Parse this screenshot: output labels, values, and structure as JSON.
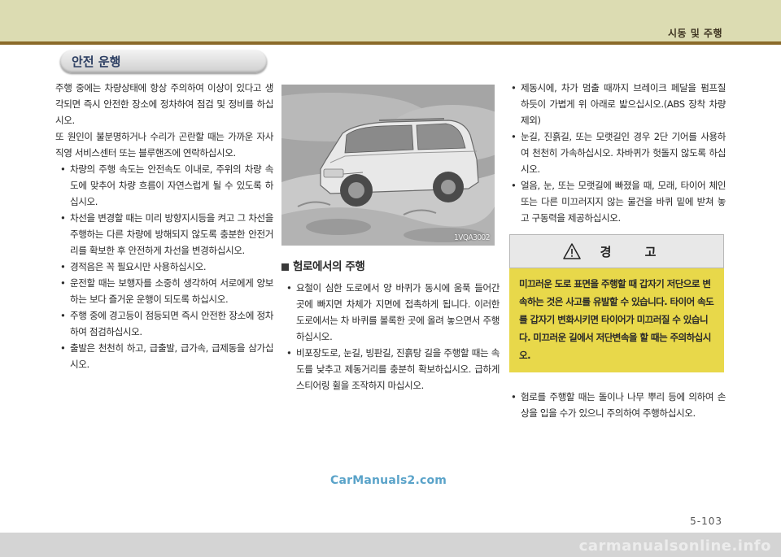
{
  "header": {
    "title": "시동 및 주행"
  },
  "section": {
    "title": "안전 운행"
  },
  "col1": {
    "para1": "주행 중에는 차량상태에 항상 주의하여 이상이 있다고 생각되면 즉시 안전한 장소에 정차하여 점검 및 정비를 하십시오.",
    "para2": "또 원인이 불분명하거나 수리가 곤란할 때는 가까운 자사 직영 서비스센터 또는 블루핸즈에 연락하십시오.",
    "bullets": [
      "차량의 주행 속도는 안전속도 이내로, 주위의 차량 속도에 맞추어 차량 흐름이 자연스럽게 될 수 있도록 하십시오.",
      "차선을 변경할 때는 미리 방향지시등을 켜고 그 차선을 주행하는 다른 차량에 방해되지 않도록 충분한 안전거리를 확보한 후 안전하게 차선을 변경하십시오.",
      "경적음은 꼭 필요시만 사용하십시오.",
      "운전할 때는 보행자를 소중히 생각하여 서로에게 양보하는 보다 즐거운 운행이 되도록 하십시오.",
      "주행 중에 경고등이 점등되면 즉시 안전한 장소에 정차하여 점검하십시오.",
      "출발은 천천히 하고, 급출발, 급가속, 급제동을 삼가십시오."
    ]
  },
  "image": {
    "code": "1VQA3002"
  },
  "col2": {
    "heading": "험로에서의 주행",
    "bullets": [
      "요철이 심한 도로에서 양 바퀴가 동시에 움푹 들어간 곳에 빠지면 차체가 지면에 접촉하게 됩니다. 이러한 도로에서는 차 바퀴를 볼록한 곳에 올려 놓으면서 주행 하십시오.",
      "비포장도로, 눈길, 빙판길, 진흙탕 길을 주행할 때는 속도를 낮추고 제동거리를 충분히 확보하십시오. 급하게 스티어링 휠을 조작하지 마십시오."
    ]
  },
  "col3": {
    "bullets": [
      "제동시에, 차가 멈출 때까지 브레이크 페달을 펌프질 하듯이 가볍게 위 아래로 밟으십시오.(ABS 장착 차량 제외)",
      "눈길, 진흙길, 또는 모랫길인 경우 2단 기어를 사용하여 천천히 가속하십시오. 차바퀴가 헛돌지 않도록 하십시오.",
      "얼음, 눈, 또는 모랫길에 빠졌을 때, 모래, 타이어 체인 또는 다른 미끄러지지 않는 물건을 바퀴 밑에 받쳐 놓고 구동력을 제공하십시오."
    ]
  },
  "warning": {
    "title": "경 고",
    "body": "미끄러운 도로 표면을 주행할 때 갑자기 저단으로 변속하는 것은 사고를 유발할 수 있습니다. 타이어 속도를 갑자기 변화시키면 타이어가 미끄러질 수 있습니다. 미끄러운 길에서 저단변속을 할 때는 주의하십시오."
  },
  "col3b": {
    "bullets": [
      "험로를 주행할 때는 돌이나 나무 뿌리 등에 의하여 손상을 입을 수가 있으니 주의하여 주행하십시오."
    ]
  },
  "page": {
    "number": "5-103"
  },
  "watermark": {
    "text": "CarManuals2.com"
  },
  "footer": {
    "text": "carmanualsonline.info"
  }
}
